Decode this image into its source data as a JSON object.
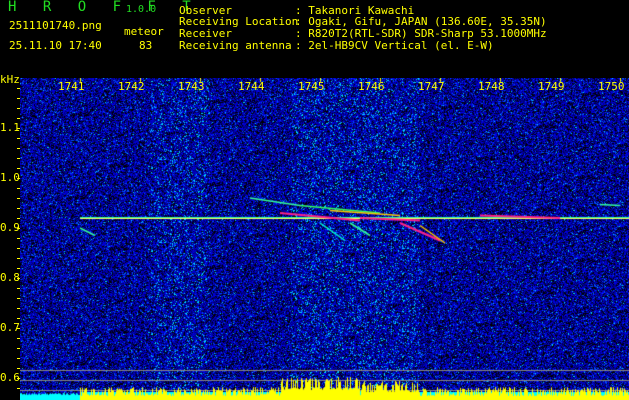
{
  "header": {
    "app_name": "H R O F F T",
    "version": "1.0.0",
    "filename": "2511101740.png",
    "datetime": "25.11.10 17:40",
    "meteor_label": "meteor",
    "meteor_count": "83"
  },
  "info": [
    {
      "key": "Observer",
      "value": ": Takanori Kawachi"
    },
    {
      "key": "Receiving Location",
      "value": ": Ogaki, Gifu, JAPAN (136.60E, 35.35N)"
    },
    {
      "key": "Receiver",
      "value": ": R820T2(RTL-SDR) SDR-Sharp 53.1000MHz"
    },
    {
      "key": "Receiving antenna",
      "value": ": 2el-HB9CV Vertical (el. E-W)"
    }
  ],
  "chart_data": {
    "type": "heatmap",
    "ylabel": "kHz",
    "x_ticks": [
      "1741",
      "1742",
      "1743",
      "1744",
      "1745",
      "1746",
      "1747",
      "1748",
      "1749",
      "1750"
    ],
    "y_ticks": [
      "1.1",
      "1.0",
      "0.9",
      "0.8",
      "0.7",
      "0.6"
    ],
    "ylim": [
      0.57,
      1.2
    ],
    "carrier_khz": 0.92,
    "colors": {
      "noise": "#0000cc",
      "carrier": "#33ff99",
      "strong": "#ff2288",
      "histogram": "#ffff00",
      "histogram_base": "#00ffff",
      "text": "#ffff00",
      "logo": "#22dd22"
    }
  }
}
